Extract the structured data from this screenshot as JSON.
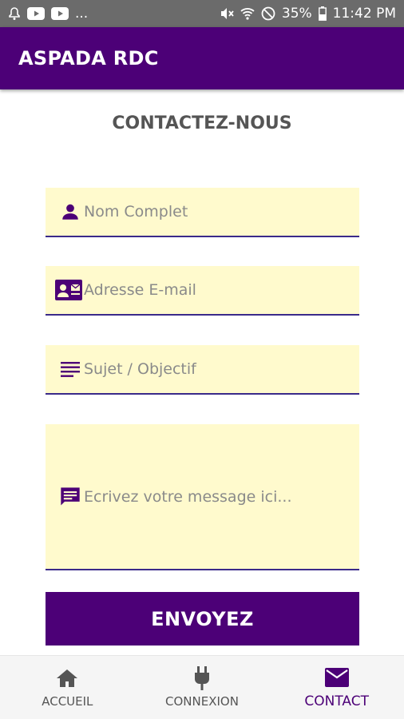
{
  "status_bar": {
    "battery_percent": "35%",
    "time": "11:42 PM",
    "overflow": "..."
  },
  "app_bar": {
    "title": "ASPADA RDC"
  },
  "page": {
    "heading": "CONTACTEZ-NOUS"
  },
  "form": {
    "name": {
      "placeholder": "Nom Complet",
      "value": "",
      "icon": "person-icon"
    },
    "email": {
      "placeholder": "Adresse E-mail",
      "value": "",
      "icon": "contact-card-icon"
    },
    "subject": {
      "placeholder": "Sujet / Objectif",
      "value": "",
      "icon": "subject-lines-icon"
    },
    "message": {
      "placeholder": "Ecrivez votre message ici...",
      "value": "",
      "icon": "message-icon"
    },
    "submit_label": "ENVOYEZ"
  },
  "bottom_nav": {
    "items": [
      {
        "label": "ACCUEIL",
        "icon": "home-icon",
        "active": false
      },
      {
        "label": "CONNEXION",
        "icon": "plug-icon",
        "active": false
      },
      {
        "label": "CONTACT",
        "icon": "mail-icon",
        "active": true
      }
    ]
  },
  "colors": {
    "primary": "#4c0077",
    "field_background": "#fffacd",
    "status_bar": "#6b6b6b",
    "nav_background": "#f5f5f5"
  }
}
